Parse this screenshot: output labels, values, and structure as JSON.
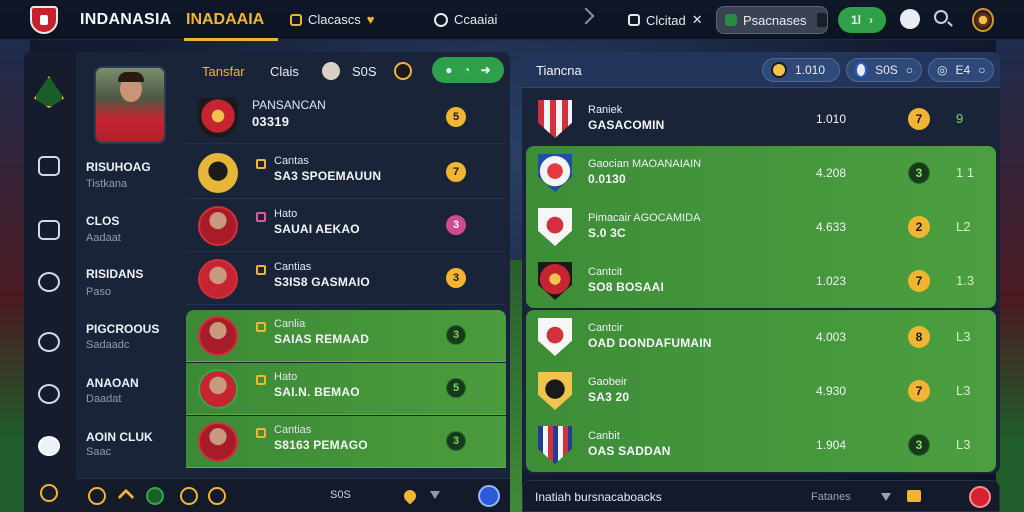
{
  "header": {
    "brand": "INDANASIA",
    "brand_accent": "INADAAIA",
    "nav_clubs": "Clacascs",
    "nav_search": "Ccaaiai",
    "nav_clients": "Clcitad",
    "pill_label": "Psacnases",
    "pill_green": "1l"
  },
  "left_panel": {
    "tabs": [
      "Tansfar",
      "Clais",
      "S0S"
    ],
    "player_name": "PANSANCAN",
    "player_id": "03319",
    "side_labels": [
      {
        "title": "RISUHOAG",
        "sub": "Tistkana"
      },
      {
        "title": "CLOS",
        "sub": "Aadaat"
      },
      {
        "title": "RISIDANS",
        "sub": "Paso"
      },
      {
        "title": "PIGCROOUS",
        "sub": "Sadaadc"
      },
      {
        "title": "ANAOAN",
        "sub": "Daadat"
      },
      {
        "title": "AOIN CLUK",
        "sub": "Saac"
      }
    ],
    "rows": [
      {
        "top": "Cantas",
        "main": "SA3 SPOEMAUUN",
        "badge": "7"
      },
      {
        "top": "Hato",
        "main": "SAUAI AEKAO",
        "badge": "3"
      },
      {
        "top": "Cantias",
        "main": "S3IS8 GASMAIO",
        "badge": "3"
      },
      {
        "top": "Canlia",
        "main": "SAIAS REMAAD",
        "badge": "3"
      },
      {
        "top": "Hato",
        "main": "SAI.N. BEMAO",
        "badge": "5"
      },
      {
        "top": "Cantias",
        "main": "S8163 PEMAGO",
        "badge": "3"
      }
    ],
    "top_badge": "5",
    "footer_text": "S0S"
  },
  "right_panel": {
    "title": "Tiancna",
    "chips": [
      "1.010",
      "S0S",
      "E4"
    ],
    "rows": [
      {
        "top": "Raniek",
        "main": "GASACOMIN",
        "value": "1.010",
        "badge": "7",
        "rank": "9"
      },
      {
        "top": "Gaocian MAOANAIAIN",
        "main": "0.0130",
        "value": "4.208",
        "badge": "3",
        "rank": "1 1"
      },
      {
        "top": "Pimacair AGOCAMIDA",
        "main": "S.0 3C",
        "value": "4.633",
        "badge": "2",
        "rank": "L2"
      },
      {
        "top": "Cantcit",
        "main": "SO8 BOSAAI",
        "value": "1.023",
        "badge": "7",
        "rank": "1.3"
      },
      {
        "top": "Cantcir",
        "main": "OAD DONDAFUMAIN",
        "value": "4.003",
        "badge": "8",
        "rank": "L3"
      },
      {
        "top": "Gaobeir",
        "main": "SA3 20",
        "value": "4.930",
        "badge": "7",
        "rank": "L3"
      },
      {
        "top": "Canbit",
        "main": "OAS SADDAN",
        "value": "1.904",
        "badge": "3",
        "rank": "L3"
      }
    ],
    "footer_text": "Inatiah  bursnacaboacks",
    "footer_label": "Fatanes"
  },
  "colors": {
    "accent": "#f2b532",
    "green": "#2fa04a",
    "panel": "#1a2439"
  }
}
